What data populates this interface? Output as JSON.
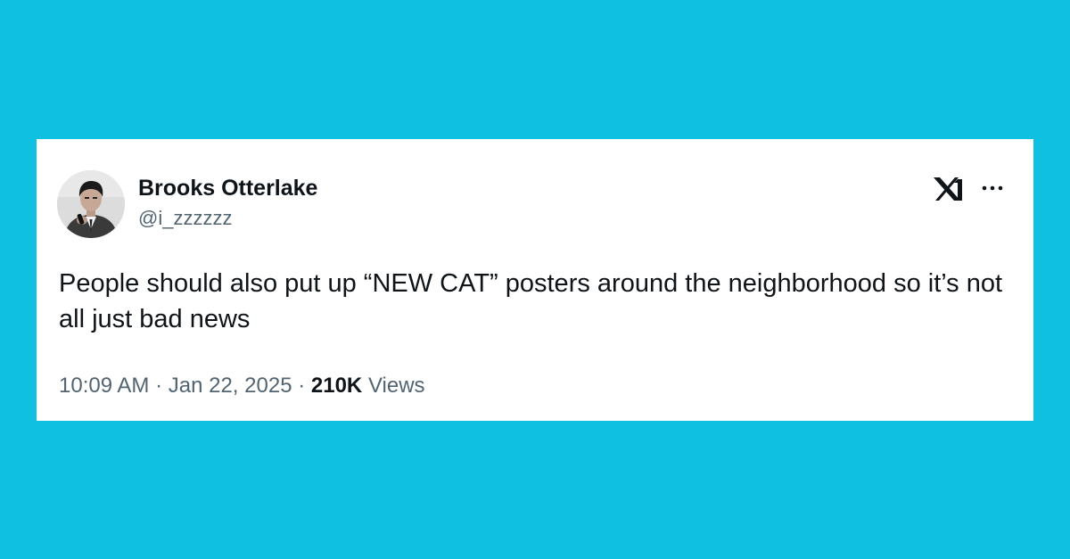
{
  "tweet": {
    "author": {
      "display_name": "Brooks Otterlake",
      "handle": "@i_zzzzzz"
    },
    "text": "People should also put up “NEW CAT” posters around the neighborhood so it’s not all just bad news",
    "time": "10:09 AM",
    "separator": "·",
    "date": "Jan 22, 2025",
    "views_count": "210K",
    "views_label": "Views"
  },
  "icons": {
    "brand": "x-logo-icon",
    "menu": "more-options-icon"
  },
  "colors": {
    "background": "#0fc0e0",
    "card": "#ffffff",
    "primary_text": "#0f1419",
    "secondary_text": "#536471"
  }
}
